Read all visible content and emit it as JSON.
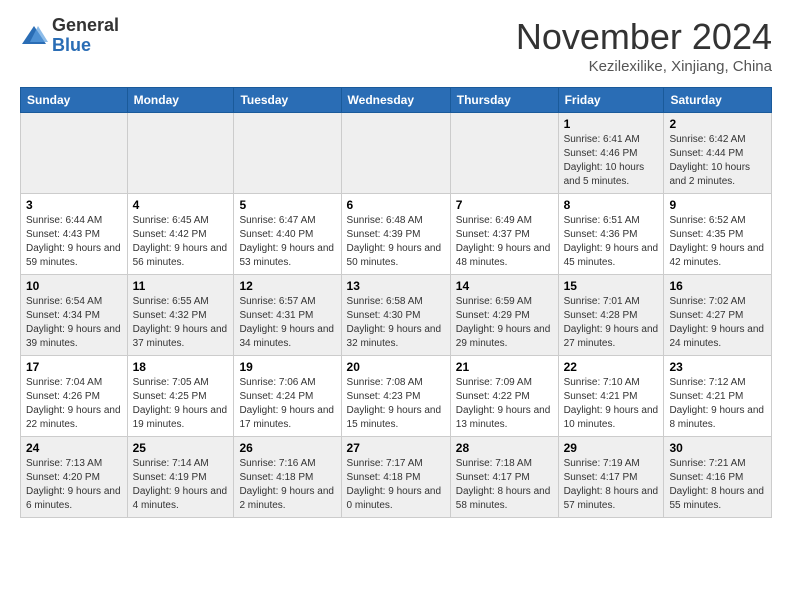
{
  "header": {
    "logo_general": "General",
    "logo_blue": "Blue",
    "month_title": "November 2024",
    "location": "Kezilexilike, Xinjiang, China"
  },
  "days_of_week": [
    "Sunday",
    "Monday",
    "Tuesday",
    "Wednesday",
    "Thursday",
    "Friday",
    "Saturday"
  ],
  "weeks": [
    [
      {
        "day": null
      },
      {
        "day": null
      },
      {
        "day": null
      },
      {
        "day": null
      },
      {
        "day": null
      },
      {
        "day": "1",
        "sunrise": "6:41 AM",
        "sunset": "4:46 PM",
        "daylight": "10 hours and 5 minutes."
      },
      {
        "day": "2",
        "sunrise": "6:42 AM",
        "sunset": "4:44 PM",
        "daylight": "10 hours and 2 minutes."
      }
    ],
    [
      {
        "day": "3",
        "sunrise": "6:44 AM",
        "sunset": "4:43 PM",
        "daylight": "9 hours and 59 minutes."
      },
      {
        "day": "4",
        "sunrise": "6:45 AM",
        "sunset": "4:42 PM",
        "daylight": "9 hours and 56 minutes."
      },
      {
        "day": "5",
        "sunrise": "6:47 AM",
        "sunset": "4:40 PM",
        "daylight": "9 hours and 53 minutes."
      },
      {
        "day": "6",
        "sunrise": "6:48 AM",
        "sunset": "4:39 PM",
        "daylight": "9 hours and 50 minutes."
      },
      {
        "day": "7",
        "sunrise": "6:49 AM",
        "sunset": "4:37 PM",
        "daylight": "9 hours and 48 minutes."
      },
      {
        "day": "8",
        "sunrise": "6:51 AM",
        "sunset": "4:36 PM",
        "daylight": "9 hours and 45 minutes."
      },
      {
        "day": "9",
        "sunrise": "6:52 AM",
        "sunset": "4:35 PM",
        "daylight": "9 hours and 42 minutes."
      }
    ],
    [
      {
        "day": "10",
        "sunrise": "6:54 AM",
        "sunset": "4:34 PM",
        "daylight": "9 hours and 39 minutes."
      },
      {
        "day": "11",
        "sunrise": "6:55 AM",
        "sunset": "4:32 PM",
        "daylight": "9 hours and 37 minutes."
      },
      {
        "day": "12",
        "sunrise": "6:57 AM",
        "sunset": "4:31 PM",
        "daylight": "9 hours and 34 minutes."
      },
      {
        "day": "13",
        "sunrise": "6:58 AM",
        "sunset": "4:30 PM",
        "daylight": "9 hours and 32 minutes."
      },
      {
        "day": "14",
        "sunrise": "6:59 AM",
        "sunset": "4:29 PM",
        "daylight": "9 hours and 29 minutes."
      },
      {
        "day": "15",
        "sunrise": "7:01 AM",
        "sunset": "4:28 PM",
        "daylight": "9 hours and 27 minutes."
      },
      {
        "day": "16",
        "sunrise": "7:02 AM",
        "sunset": "4:27 PM",
        "daylight": "9 hours and 24 minutes."
      }
    ],
    [
      {
        "day": "17",
        "sunrise": "7:04 AM",
        "sunset": "4:26 PM",
        "daylight": "9 hours and 22 minutes."
      },
      {
        "day": "18",
        "sunrise": "7:05 AM",
        "sunset": "4:25 PM",
        "daylight": "9 hours and 19 minutes."
      },
      {
        "day": "19",
        "sunrise": "7:06 AM",
        "sunset": "4:24 PM",
        "daylight": "9 hours and 17 minutes."
      },
      {
        "day": "20",
        "sunrise": "7:08 AM",
        "sunset": "4:23 PM",
        "daylight": "9 hours and 15 minutes."
      },
      {
        "day": "21",
        "sunrise": "7:09 AM",
        "sunset": "4:22 PM",
        "daylight": "9 hours and 13 minutes."
      },
      {
        "day": "22",
        "sunrise": "7:10 AM",
        "sunset": "4:21 PM",
        "daylight": "9 hours and 10 minutes."
      },
      {
        "day": "23",
        "sunrise": "7:12 AM",
        "sunset": "4:21 PM",
        "daylight": "9 hours and 8 minutes."
      }
    ],
    [
      {
        "day": "24",
        "sunrise": "7:13 AM",
        "sunset": "4:20 PM",
        "daylight": "9 hours and 6 minutes."
      },
      {
        "day": "25",
        "sunrise": "7:14 AM",
        "sunset": "4:19 PM",
        "daylight": "9 hours and 4 minutes."
      },
      {
        "day": "26",
        "sunrise": "7:16 AM",
        "sunset": "4:18 PM",
        "daylight": "9 hours and 2 minutes."
      },
      {
        "day": "27",
        "sunrise": "7:17 AM",
        "sunset": "4:18 PM",
        "daylight": "9 hours and 0 minutes."
      },
      {
        "day": "28",
        "sunrise": "7:18 AM",
        "sunset": "4:17 PM",
        "daylight": "8 hours and 58 minutes."
      },
      {
        "day": "29",
        "sunrise": "7:19 AM",
        "sunset": "4:17 PM",
        "daylight": "8 hours and 57 minutes."
      },
      {
        "day": "30",
        "sunrise": "7:21 AM",
        "sunset": "4:16 PM",
        "daylight": "8 hours and 55 minutes."
      }
    ]
  ]
}
